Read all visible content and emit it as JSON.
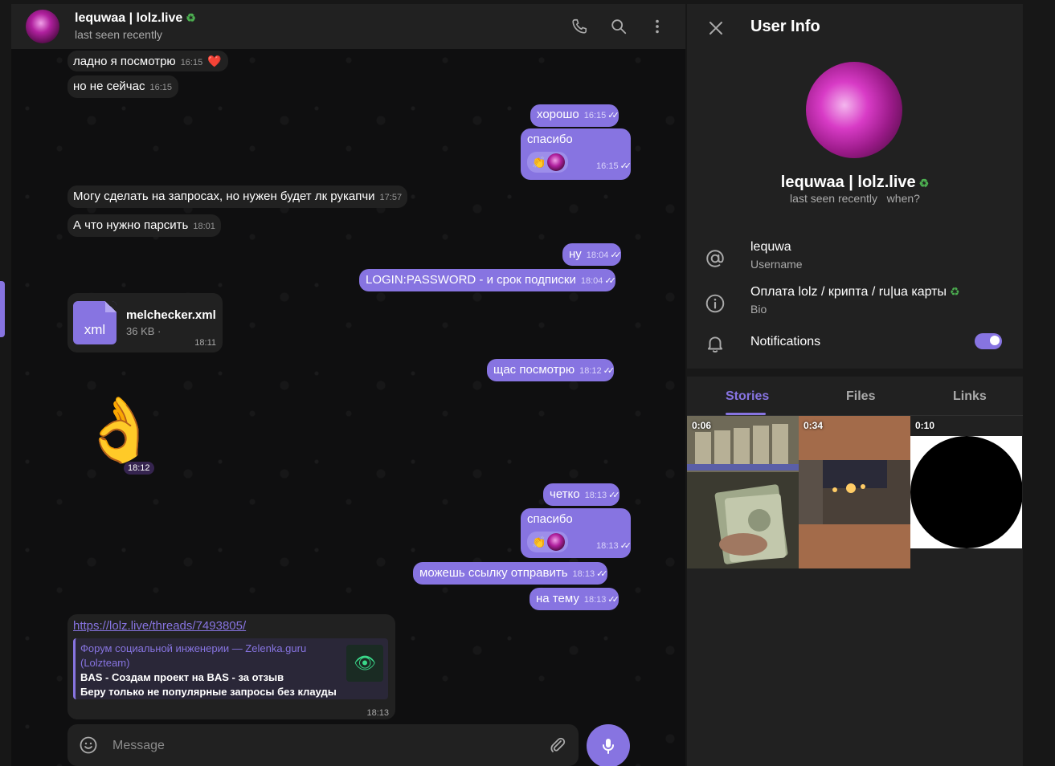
{
  "header": {
    "title": "lequwaa | lolz.live",
    "eco_icon": "recycle-icon",
    "status": "last seen recently"
  },
  "messages": {
    "m1": {
      "text": "ладно я посмотрю",
      "time": "16:15",
      "reaction": "❤️"
    },
    "m2": {
      "text": "но не сейчас",
      "time": "16:15"
    },
    "m3": {
      "text": "хорошо",
      "time": "16:15"
    },
    "m4": {
      "text": "спасибо",
      "time": "16:15",
      "reaction": "👏"
    },
    "m5": {
      "text": "Могу сделать на запросах, но нужен будет лк рукапчи",
      "time": "17:57"
    },
    "m6": {
      "text": "А что нужно парсить",
      "time": "18:01"
    },
    "m7": {
      "text": "ну",
      "time": "18:04"
    },
    "m8": {
      "text": "LOGIN:PASSWORD - и срок подписки",
      "time": "18:04"
    },
    "file": {
      "ext": "xml",
      "name": "melchecker.xml",
      "size": "36 KB ·",
      "time": "18:11"
    },
    "m9": {
      "text": "щас посмотрю",
      "time": "18:12"
    },
    "sticker": {
      "emoji": "👌",
      "time": "18:12"
    },
    "m10": {
      "text": "четко",
      "time": "18:13"
    },
    "m11": {
      "text": "спасибо",
      "time": "18:13",
      "reaction": "👏"
    },
    "m12": {
      "text": "можешь ссылку отправить",
      "time": "18:13"
    },
    "m13": {
      "text": "на тему",
      "time": "18:13"
    },
    "link": {
      "url": "https://lolz.live/threads/7493805/",
      "site": "Форум социальной инженерии — Zelenka.guru (Lolzteam)",
      "title": "BAS - Создам проект на BAS - за отзыв",
      "desc": "Беру только не популярные запросы без клауды",
      "time": "18:13"
    }
  },
  "composer": {
    "placeholder": "Message"
  },
  "info": {
    "title": "User Info",
    "name": "lequwaa | lolz.live",
    "seen": "last seen recently",
    "seen_link": "when?",
    "username": "lequwa",
    "username_label": "Username",
    "bio": "Оплата lolz / крипта / ru|ua карты",
    "bio_label": "Bio",
    "notifications": "Notifications",
    "notifications_on": true,
    "tabs": [
      "Stories",
      "Files",
      "Links"
    ],
    "stories": [
      "0:06",
      "0:34",
      "0:10"
    ]
  },
  "colors": {
    "accent": "#8774e1",
    "panel": "#212121",
    "eco": "#4caf50"
  }
}
